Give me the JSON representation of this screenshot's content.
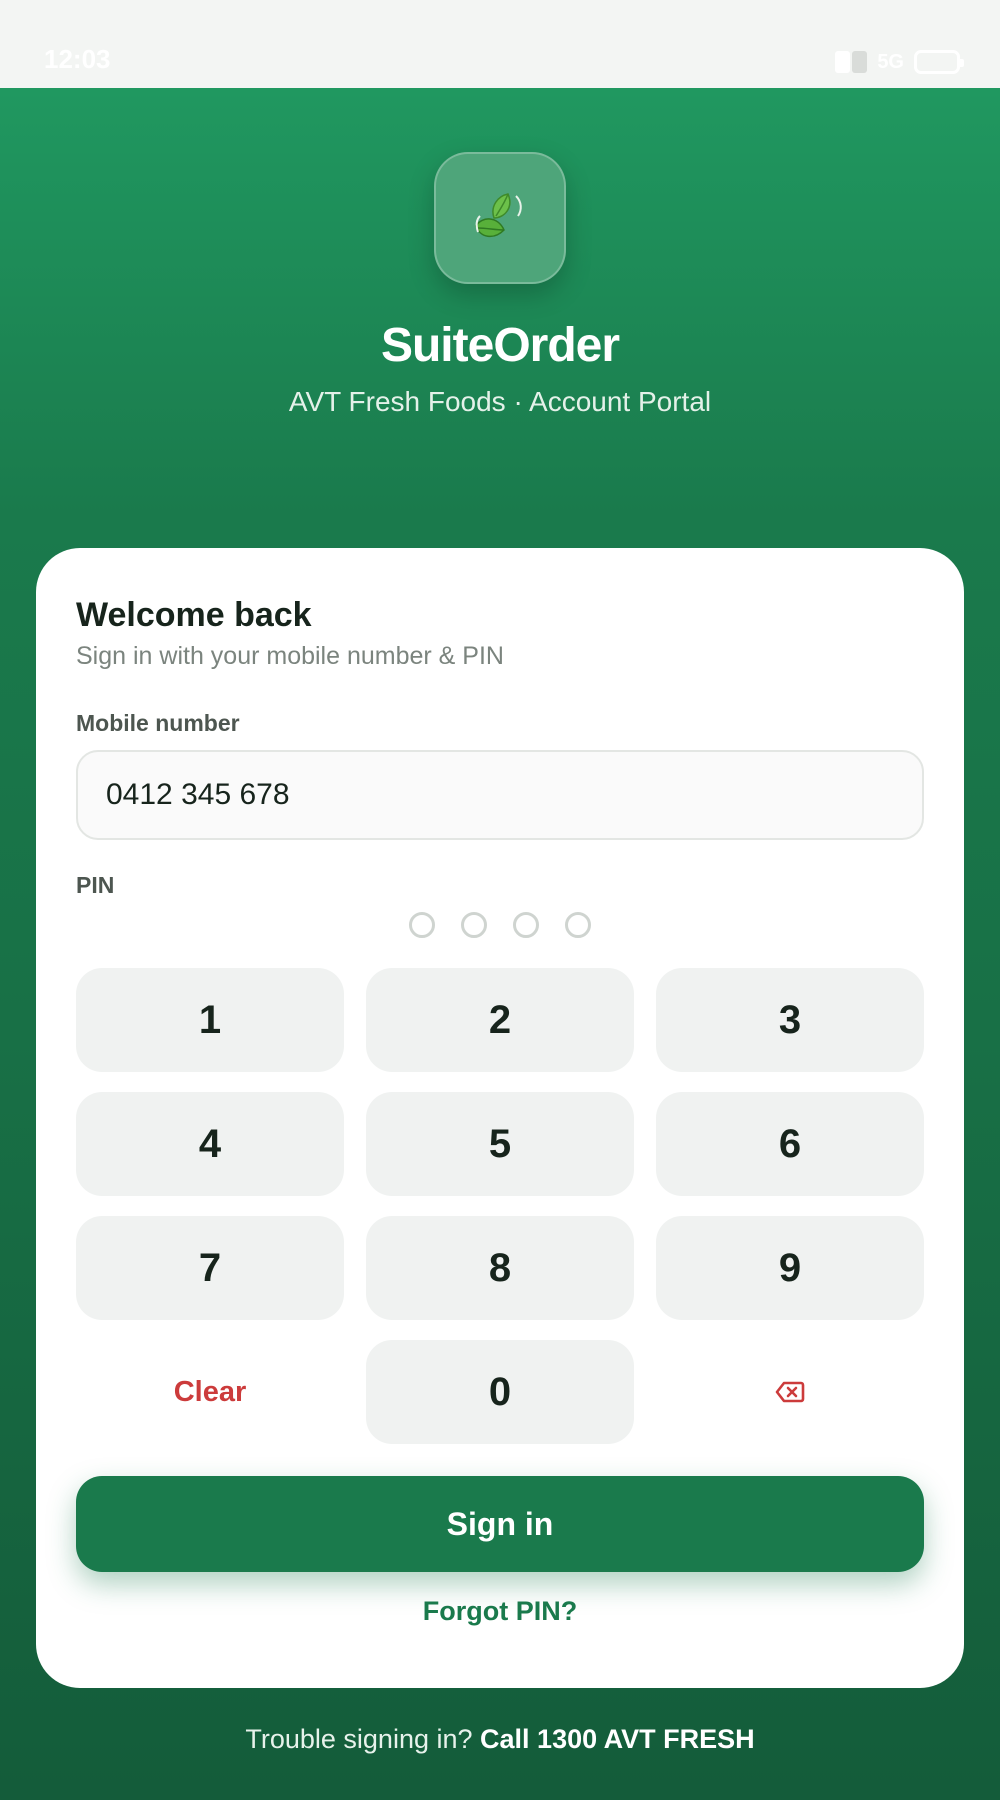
{
  "status_bar": {
    "time": "12:03",
    "network": "5G",
    "icons": [
      "signal-icon",
      "battery-icon"
    ]
  },
  "app": {
    "icon": "leaf-icon",
    "title": "SuiteOrder",
    "subtitle": "AVT Fresh Foods · Account Portal"
  },
  "login": {
    "heading": "Welcome back",
    "subheading": "Sign in with your mobile number & PIN",
    "mobile_label": "Mobile number",
    "mobile_value": "0412 345 678",
    "pin_label": "PIN",
    "pin_length": 4,
    "pin_entered": 0,
    "keys": [
      "1",
      "2",
      "3",
      "4",
      "5",
      "6",
      "7",
      "8",
      "9"
    ],
    "clear_label": "Clear",
    "zero_key": "0",
    "backspace_icon": "backspace-icon",
    "signin_label": "Sign in",
    "forgot_label": "Forgot PIN?"
  },
  "footer": {
    "prefix": "Trouble signing in?",
    "call_label": "Call 1300 AVT FRESH"
  },
  "colors": {
    "brand_green": "#1a7a4c",
    "danger_red": "#cc3b3b",
    "key_bg": "#f0f2f1"
  }
}
